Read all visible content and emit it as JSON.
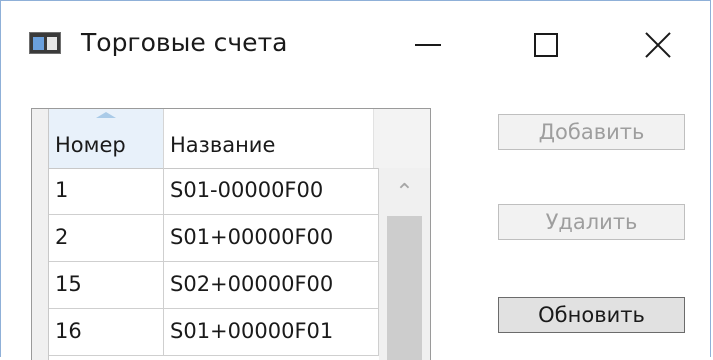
{
  "window": {
    "title": "Торговые счета",
    "controls": {
      "minimize_icon": "minimize-icon",
      "maximize_icon": "maximize-icon",
      "close_icon": "close-icon"
    }
  },
  "grid": {
    "columns": [
      {
        "label": "Номер",
        "sorted": "ascending"
      },
      {
        "label": "Название"
      }
    ],
    "rows": [
      {
        "number": "1",
        "name": "S01-00000F00"
      },
      {
        "number": "2",
        "name": "S01+00000F00"
      },
      {
        "number": "15",
        "name": "S02+00000F00"
      },
      {
        "number": "16",
        "name": "S01+00000F01"
      }
    ]
  },
  "buttons": {
    "add": {
      "label": "Добавить",
      "enabled": false
    },
    "delete": {
      "label": "Удалить",
      "enabled": false
    },
    "refresh": {
      "label": "Обновить",
      "enabled": true
    }
  },
  "colors": {
    "window_border": "#8fb0d8",
    "sorted_header": "#e8f1fa",
    "disabled_text": "#9e9e9e"
  }
}
